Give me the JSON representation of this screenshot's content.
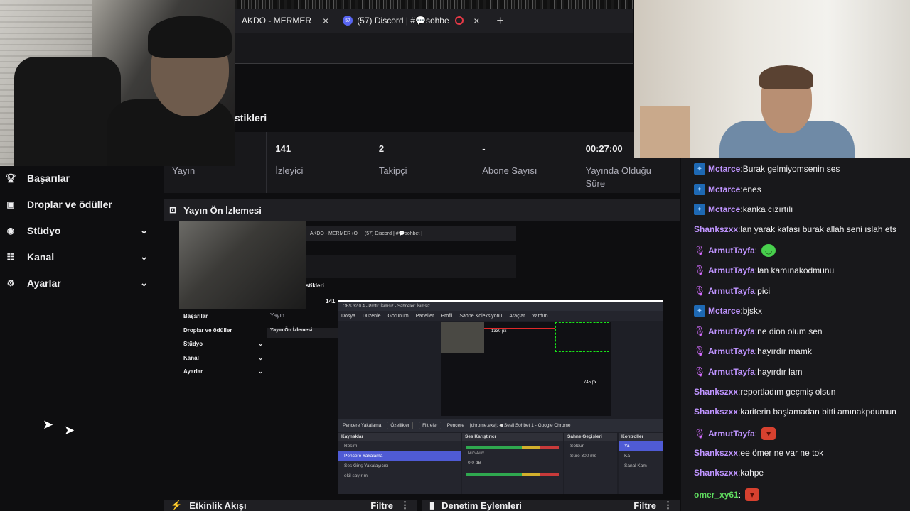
{
  "browser": {
    "tabs": [
      {
        "title": "AKDO - MERMER (Of",
        "close": "×"
      },
      {
        "title": "(57) Discord | #💬sohbet | C",
        "badge": "57",
        "close": "×"
      }
    ],
    "new_tab": "+"
  },
  "stats": {
    "title": "stikleri",
    "items": [
      {
        "value": "",
        "label": "Yayın"
      },
      {
        "value": "141",
        "label": "İzleyici"
      },
      {
        "value": "2",
        "label": "Takipçi"
      },
      {
        "value": "-",
        "label": "Abone Sayısı"
      },
      {
        "value": "00:27:00",
        "label": "Yayında Olduğu Süre"
      }
    ]
  },
  "sidebar": {
    "items": [
      {
        "label": "Başarılar",
        "icon": "trophy-icon",
        "expandable": false
      },
      {
        "label": "Droplar ve ödüller",
        "icon": "gift-icon",
        "expandable": false
      },
      {
        "label": "Stüdyo",
        "icon": "studio-icon",
        "expandable": true
      },
      {
        "label": "Kanal",
        "icon": "channel-icon",
        "expandable": true
      },
      {
        "label": "Ayarlar",
        "icon": "gear-icon",
        "expandable": true
      }
    ]
  },
  "preview": {
    "title": "Yayın Ön İzlemesi",
    "mini": {
      "tabs": [
        "AKDO - MERMER (O",
        "(57) Discord | #💬sohbet |"
      ],
      "stat_title": "stikleri",
      "stat_value": "141",
      "stat_label": "Yayın",
      "preview_title": "Yayın Ön İzlemesi",
      "sidebar": [
        "Başarılar",
        "Droplar ve ödüller",
        "Stüdyo",
        "Kanal",
        "Ayarlar"
      ]
    },
    "obs": {
      "title": "OBS 32.0.4 - Profil: İsimsiz - Sahneler: İsimsiz",
      "menu": [
        "Dosya",
        "Düzenle",
        "Görünüm",
        "Paneller",
        "Profil",
        "Sahne Koleksiyonu",
        "Araçlar",
        "Yardım"
      ],
      "canvas_labels": [
        "1330 px",
        "745 px"
      ],
      "source_bar": [
        "Pencere Yakalama",
        "Özellikler",
        "Filtreler",
        "Pencere",
        "[chrome.exe]: ◀ Sesli Sohbet 1 - Google Chrome"
      ],
      "docks": {
        "sources": {
          "title": "Kaynaklar",
          "rows": [
            "Resim",
            "Pencere Yakalama",
            "Ses Giriş Yakalayıcısı",
            "ekil sayırım"
          ]
        },
        "mixer": {
          "title": "Ses Karıştırıcı",
          "rows": [
            "Mic/Aux",
            "0.0 dB"
          ]
        },
        "transitions": {
          "title": "Sahne Geçişleri",
          "rows": [
            "Soldur",
            "Süre  300 ms"
          ]
        },
        "controls": {
          "title": "Kontroller",
          "rows": [
            "Ya",
            "Ka",
            "Sanal Kam"
          ]
        }
      }
    }
  },
  "bottom": {
    "left": {
      "title": "Etkinlik Akışı",
      "filter": "Filtre"
    },
    "right": {
      "title": "Denetim Eylemleri",
      "filter": "Filtre"
    }
  },
  "chat": {
    "colors": {
      "streamer": "#3aa0ff",
      "purple": "#bf94ff",
      "green": "#5fdb5f"
    },
    "messages": [
      {
        "user": "Mctarce",
        "badge": "streamer",
        "text": "Burak gelmiyomsenin ses",
        "color": "#bf94ff"
      },
      {
        "user": "Mctarce",
        "badge": "streamer",
        "text": "enes",
        "color": "#bf94ff"
      },
      {
        "user": "Mctarce",
        "badge": "streamer",
        "text": "kanka cızırtılı",
        "color": "#bf94ff"
      },
      {
        "user": "Shankszxx",
        "badge": "",
        "text": "lan yarak kafası burak allah seni ıslah ets",
        "color": "#bf94ff"
      },
      {
        "user": "ArmutTayfa",
        "badge": "mic",
        "text": "",
        "emote": "green",
        "color": "#bf94ff"
      },
      {
        "user": "ArmutTayfa",
        "badge": "mic",
        "text": "lan kamınakodmunu",
        "color": "#bf94ff"
      },
      {
        "user": "ArmutTayfa",
        "badge": "mic",
        "text": "pici",
        "color": "#bf94ff"
      },
      {
        "user": "Mctarce",
        "badge": "streamer",
        "text": "bjskx",
        "color": "#bf94ff"
      },
      {
        "user": "ArmutTayfa",
        "badge": "mic",
        "text": "ne dion olum sen",
        "color": "#bf94ff"
      },
      {
        "user": "ArmutTayfa",
        "badge": "mic",
        "text": "hayırdır mamk",
        "color": "#bf94ff"
      },
      {
        "user": "ArmutTayfa",
        "badge": "mic",
        "text": "hayırdır lam",
        "color": "#bf94ff"
      },
      {
        "user": "Shankszxx",
        "badge": "",
        "text": "reportladım geçmiş olsun",
        "color": "#bf94ff"
      },
      {
        "user": "Shankszxx",
        "badge": "",
        "text": "kariterin başlamadan bitti amınakpdumun",
        "color": "#bf94ff"
      },
      {
        "user": "ArmutTayfa",
        "badge": "mic",
        "text": "",
        "emote": "red",
        "color": "#bf94ff"
      },
      {
        "user": "Shankszxx",
        "badge": "",
        "text": "ee ömer ne var ne tok",
        "color": "#bf94ff"
      },
      {
        "user": "Shankszxx",
        "badge": "",
        "text": "kahpe",
        "color": "#bf94ff"
      },
      {
        "user": "omer_xy61",
        "badge": "",
        "text": "",
        "emote": "red",
        "color": "#5fdb5f"
      }
    ]
  }
}
